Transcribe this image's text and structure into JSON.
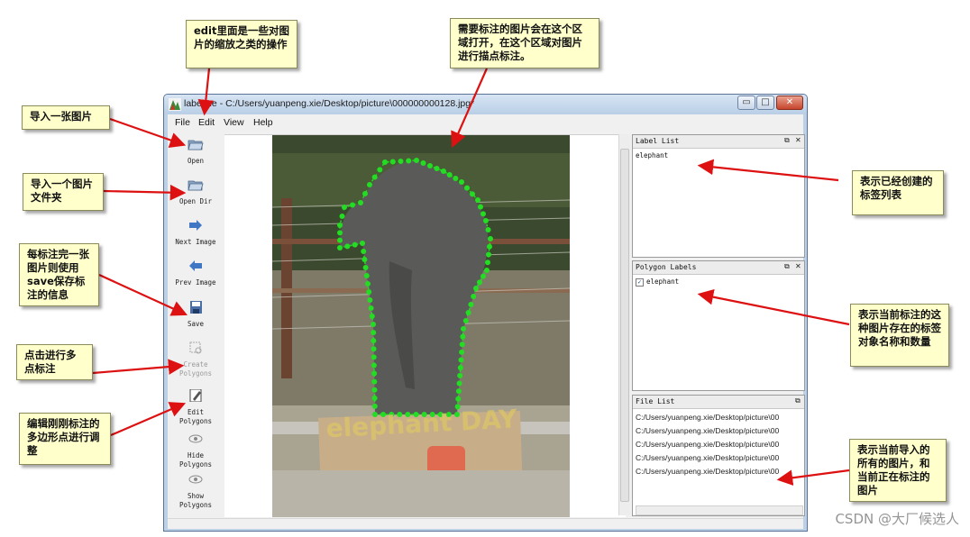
{
  "window": {
    "title": "labelme - C:/Users/yuanpeng.xie/Desktop/picture\\000000000128.jpg*",
    "controls": [
      "▭",
      "□",
      "✕"
    ]
  },
  "menu": [
    "File",
    "Edit",
    "View",
    "Help"
  ],
  "toolbar": [
    {
      "label": "Open",
      "icon": "folder-open-icon",
      "enabled": true
    },
    {
      "label": "Open Dir",
      "icon": "folder-open-icon",
      "enabled": true
    },
    {
      "label": "Next Image",
      "icon": "arrow-right-icon",
      "enabled": true
    },
    {
      "label": "Prev Image",
      "icon": "arrow-left-icon",
      "enabled": true
    },
    {
      "label": "Save",
      "icon": "floppy-disk-icon",
      "enabled": true
    },
    {
      "label": "Create\nPolygons",
      "icon": "create-polygon-icon",
      "enabled": false
    },
    {
      "label": "Edit\nPolygons",
      "icon": "edit-pencil-icon",
      "enabled": true
    },
    {
      "label": "Hide\nPolygons",
      "icon": "eye-icon",
      "enabled": true
    },
    {
      "label": "Show\nPolygons",
      "icon": "eye-icon",
      "enabled": true
    }
  ],
  "canvas": {
    "image_text": "elephant DAY",
    "polygon_color": "#22dd22"
  },
  "docks": {
    "label_list": {
      "title": "Label List",
      "items": [
        "elephant"
      ]
    },
    "polygon_labels": {
      "title": "Polygon Labels",
      "items": [
        {
          "label": "elephant",
          "checked": true
        }
      ]
    },
    "file_list": {
      "title": "File List",
      "items": [
        "C:/Users/yuanpeng.xie/Desktop/picture\\00",
        "C:/Users/yuanpeng.xie/Desktop/picture\\00",
        "C:/Users/yuanpeng.xie/Desktop/picture\\00",
        "C:/Users/yuanpeng.xie/Desktop/picture\\00",
        "C:/Users/yuanpeng.xie/Desktop/picture\\00"
      ]
    }
  },
  "callouts": {
    "edit_note": "edit里面是一些对图片的缩放之类的操作",
    "canvas_note": "需要标注的图片会在这个区域打开，在这个区域对图片进行描点标注。",
    "open_note": "导入一张图片",
    "open_dir_note": "导入一个图片文件夹",
    "save_note": "每标注完一张图片则使用save保存标注的信息",
    "create_note": "点击进行多点标注",
    "edit_poly_note": "编辑刚刚标注的多边形点进行调整",
    "label_list_note": "表示已经创建的标签列表",
    "polygon_labels_note": "表示当前标注的这种图片存在的标签对象名称和数量",
    "file_list_note": "表示当前导入的所有的图片，和当前正在标注的图片"
  },
  "colors": {
    "arrow": "#dd1111",
    "callout_bg": "#ffffcc"
  },
  "watermark": "CSDN @大厂候选人"
}
